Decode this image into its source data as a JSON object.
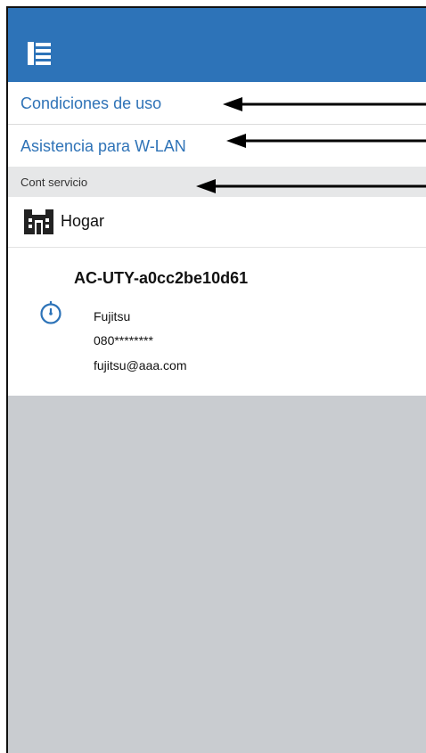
{
  "menu": {
    "items": [
      {
        "label": "Condiciones de uso"
      },
      {
        "label": "Asistencia para W-LAN"
      }
    ],
    "section_label": "Cont servicio"
  },
  "place": {
    "name": "Hogar"
  },
  "device": {
    "name": "AC-UTY-a0cc2be10d61",
    "company": "Fujitsu",
    "phone": "080********",
    "email": "fujitsu@aaa.com"
  },
  "colors": {
    "header_blue": "#2d73b8",
    "link_blue": "#2f73b7",
    "background_gray": "#c9ccd0"
  },
  "icons": {
    "menu": "menu-icon",
    "home": "home-icon",
    "clock": "timer-icon",
    "arrows": "annotation-arrow"
  }
}
